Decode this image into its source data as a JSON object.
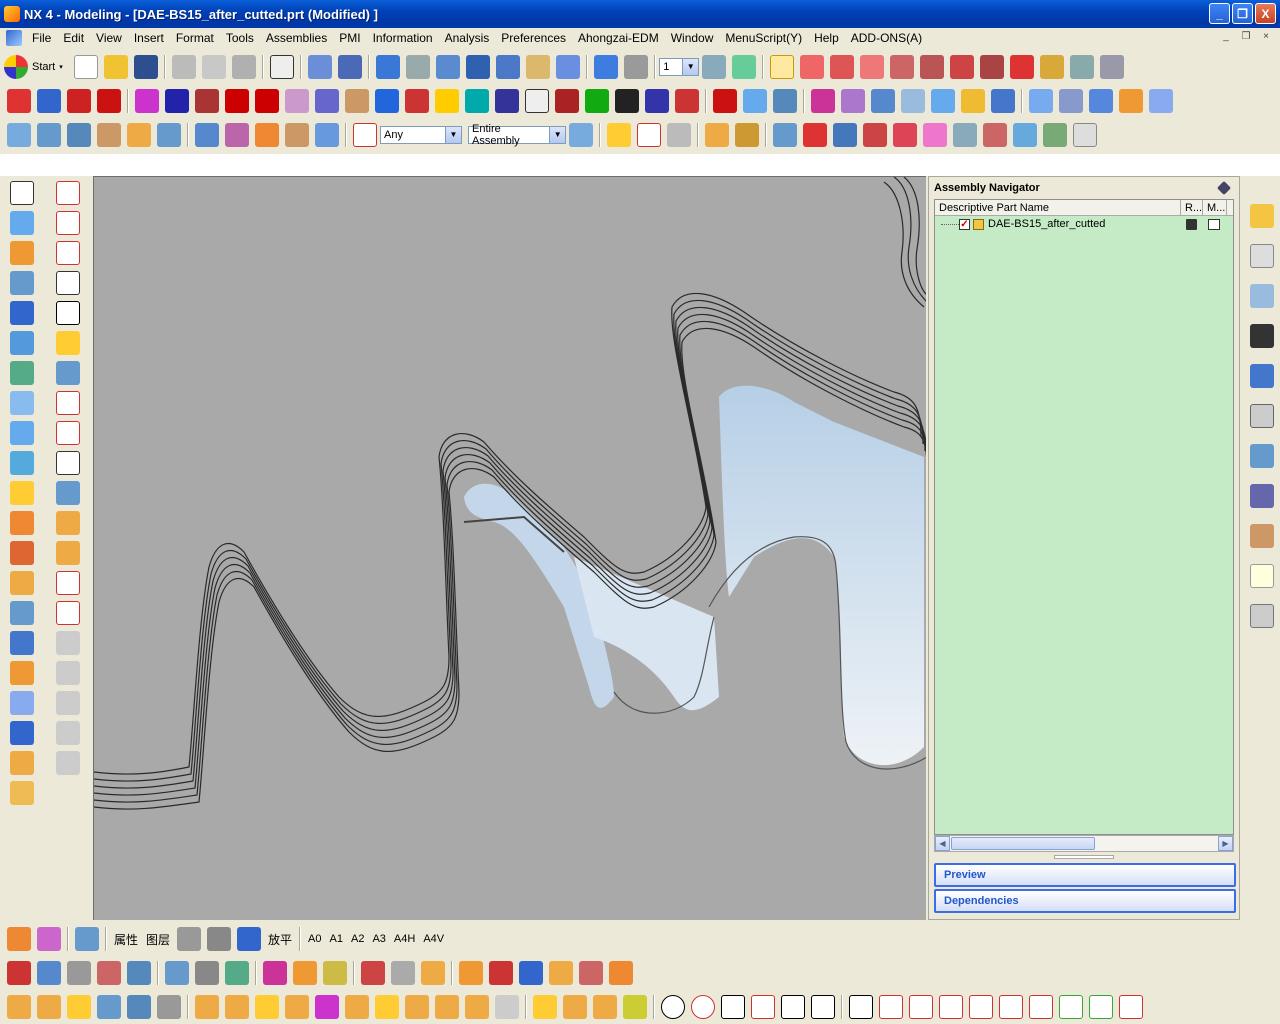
{
  "window": {
    "title": "NX 4 - Modeling - [DAE-BS15_after_cutted.prt (Modified) ]",
    "minimize_label": "_",
    "restore_label": "❐",
    "close_label": "X"
  },
  "menubar": {
    "items": [
      "File",
      "Edit",
      "View",
      "Insert",
      "Format",
      "Tools",
      "Assemblies",
      "PMI",
      "Information",
      "Analysis",
      "Preferences",
      "Ahongzai-EDM",
      "Window",
      "MenuScript(Y)",
      "Help",
      "ADD-ONS(A)"
    ]
  },
  "toolbar": {
    "start_label": "Start",
    "layer_value": "1",
    "selection_filter": "Any",
    "selection_scope": "Entire Assembly"
  },
  "assembly_navigator": {
    "title": "Assembly Navigator",
    "columns": [
      "Descriptive Part Name",
      "R...",
      "M..."
    ],
    "rows": [
      {
        "name": "DAE-BS15_after_cutted"
      }
    ],
    "panels": [
      "Preview",
      "Dependencies"
    ]
  },
  "bottom_toolbar": {
    "attr_label": "属性",
    "layer_label": "图层",
    "flatten_label": "放平",
    "sheet_labels": [
      "A0",
      "A1",
      "A2",
      "A3",
      "A4H",
      "A4V"
    ]
  },
  "colors": {
    "title_bar": "#0a5fd8",
    "navigator_bg": "#c5ebc6",
    "viewport_bg": "#a9a9a9",
    "panel_border": "#3a6ee8"
  }
}
